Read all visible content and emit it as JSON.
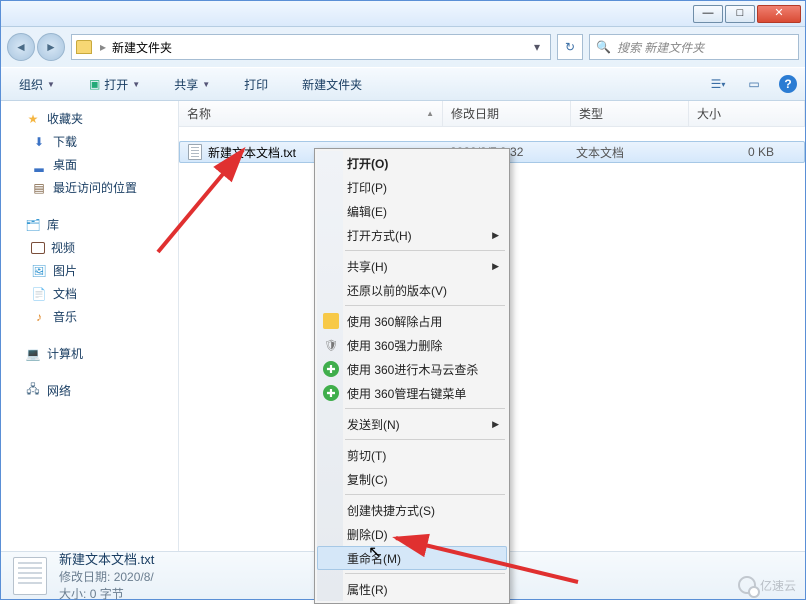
{
  "breadcrumb": {
    "root_sep": "▸",
    "current": "新建文件夹"
  },
  "search": {
    "placeholder": "搜索 新建文件夹"
  },
  "toolbar": {
    "organize": "组织",
    "open": "打开",
    "share": "共享",
    "print": "打印",
    "newfolder": "新建文件夹"
  },
  "columns": {
    "name": "名称",
    "date": "修改日期",
    "type": "类型",
    "size": "大小"
  },
  "sidebar": {
    "favorites": "收藏夹",
    "downloads": "下载",
    "desktop": "桌面",
    "recent": "最近访问的位置",
    "libraries": "库",
    "videos": "视频",
    "pictures": "图片",
    "documents": "文档",
    "music": "音乐",
    "computer": "计算机",
    "network": "网络"
  },
  "files": [
    {
      "name": "新建文本文档.txt",
      "date": "2020/8/7 9:32",
      "type": "文本文档",
      "size": "0 KB"
    }
  ],
  "context_menu": {
    "open": "打开(O)",
    "print": "打印(P)",
    "edit": "编辑(E)",
    "openwith": "打开方式(H)",
    "share": "共享(H)",
    "restore": "还原以前的版本(V)",
    "unlock360": "使用 360解除占用",
    "forcedel360": "使用 360强力删除",
    "scan360": "使用 360进行木马云查杀",
    "menu360": "使用 360管理右键菜单",
    "sendto": "发送到(N)",
    "cut": "剪切(T)",
    "copy": "复制(C)",
    "shortcut": "创建快捷方式(S)",
    "delete": "删除(D)",
    "rename": "重命名(M)",
    "properties": "属性(R)"
  },
  "details": {
    "name": "新建文本文档.txt",
    "date_lbl": "修改日期:",
    "date_val": "2020/8/",
    "size_lbl": "大小:",
    "size_val": "0 字节"
  },
  "watermark": "亿速云"
}
